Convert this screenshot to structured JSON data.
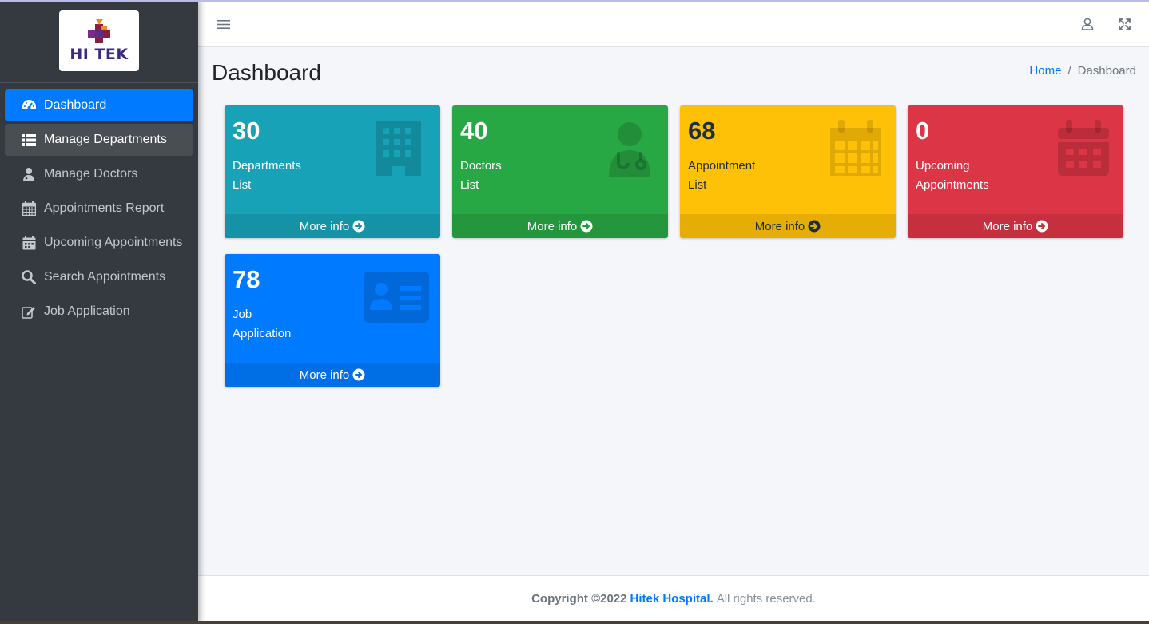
{
  "brand": {
    "logo_text": "HI TEK"
  },
  "sidebar": {
    "items": [
      {
        "label": "Dashboard",
        "icon": "tachometer-icon"
      },
      {
        "label": "Manage Departments",
        "icon": "list-icon"
      },
      {
        "label": "Manage Doctors",
        "icon": "user-md-icon"
      },
      {
        "label": "Appointments Report",
        "icon": "calendar-icon"
      },
      {
        "label": "Upcoming Appointments",
        "icon": "calendar-icon"
      },
      {
        "label": "Search Appointments",
        "icon": "search-icon"
      },
      {
        "label": "Job Application",
        "icon": "edit-icon"
      }
    ]
  },
  "header": {
    "menu_icon": "hamburger-icon",
    "user_icon": "user-icon",
    "fullscreen_icon": "expand-icon"
  },
  "page": {
    "title": "Dashboard",
    "breadcrumb": {
      "home": "Home",
      "separator": "/",
      "current": "Dashboard"
    }
  },
  "cards": [
    {
      "count": "30",
      "label_line1": "Departments",
      "label_line2": "List",
      "more": "More info",
      "icon": "building-icon",
      "color": "#17a2b8"
    },
    {
      "count": "40",
      "label_line1": "Doctors",
      "label_line2": "List",
      "more": "More info",
      "icon": "doctor-icon",
      "color": "#28a745"
    },
    {
      "count": "68",
      "label_line1": "Appointment",
      "label_line2": "List",
      "more": "More info",
      "icon": "calendar-icon",
      "color": "#ffc107"
    },
    {
      "count": "0",
      "label_line1": "Upcoming",
      "label_line2": "Appointments",
      "more": "More info",
      "icon": "calendar-icon",
      "color": "#dc3545"
    },
    {
      "count": "78",
      "label_line1": "Job",
      "label_line2": "Application",
      "more": "More info",
      "icon": "id-card-icon",
      "color": "#007bff"
    }
  ],
  "footer": {
    "copyright": "Copyright ©2022",
    "brand": "Hitek Hospital.",
    "rest": "All rights reserved."
  }
}
